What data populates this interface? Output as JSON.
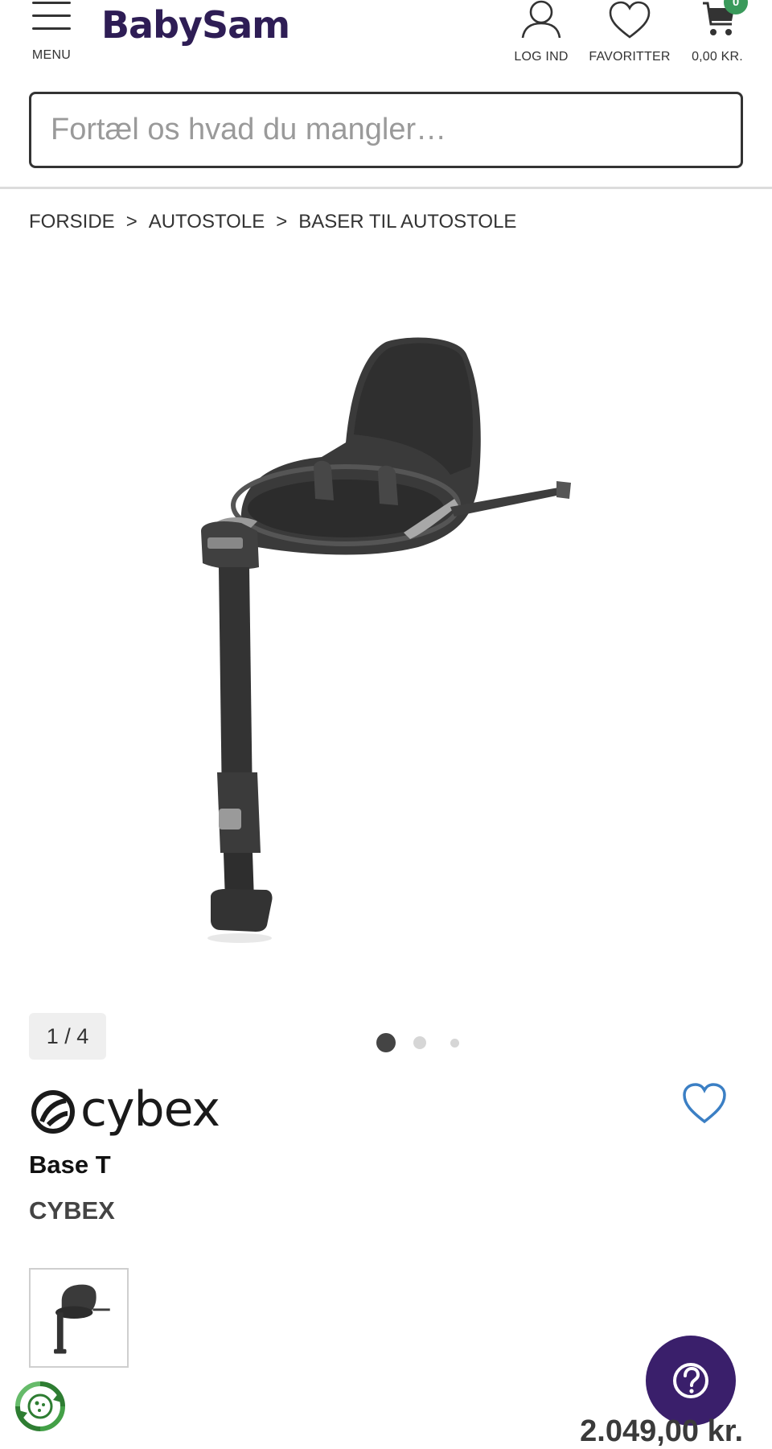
{
  "header": {
    "menu_label": "MENU",
    "logo_text": "BabySam",
    "login_label": "LOG IND",
    "favorites_label": "FAVORITTER",
    "cart_label": "0,00 KR.",
    "cart_count": "0"
  },
  "search": {
    "placeholder": "Fortæl os hvad du mangler…"
  },
  "breadcrumb": {
    "separator": ">",
    "items": [
      "FORSIDE",
      "AUTOSTOLE",
      "BASER TIL AUTOSTOLE"
    ]
  },
  "gallery": {
    "counter": "1 / 4",
    "active_dot": 0,
    "dot_count": 3
  },
  "product": {
    "brand_logo_text": "cybex",
    "name": "Base T",
    "brand": "CYBEX",
    "price": "2.049,00 kr."
  },
  "colors": {
    "brand": "#2e1d55",
    "cart_badge": "#3a9a5b",
    "favorite_heart": "#3b7fc4",
    "help_button": "#3a1f6b"
  },
  "icons": {
    "menu": "hamburger-icon",
    "login": "user-icon",
    "favorites": "heart-icon",
    "cart": "cart-icon",
    "favorite_toggle": "heart-outline-icon",
    "help": "question-icon",
    "eco": "recycle-icon"
  }
}
